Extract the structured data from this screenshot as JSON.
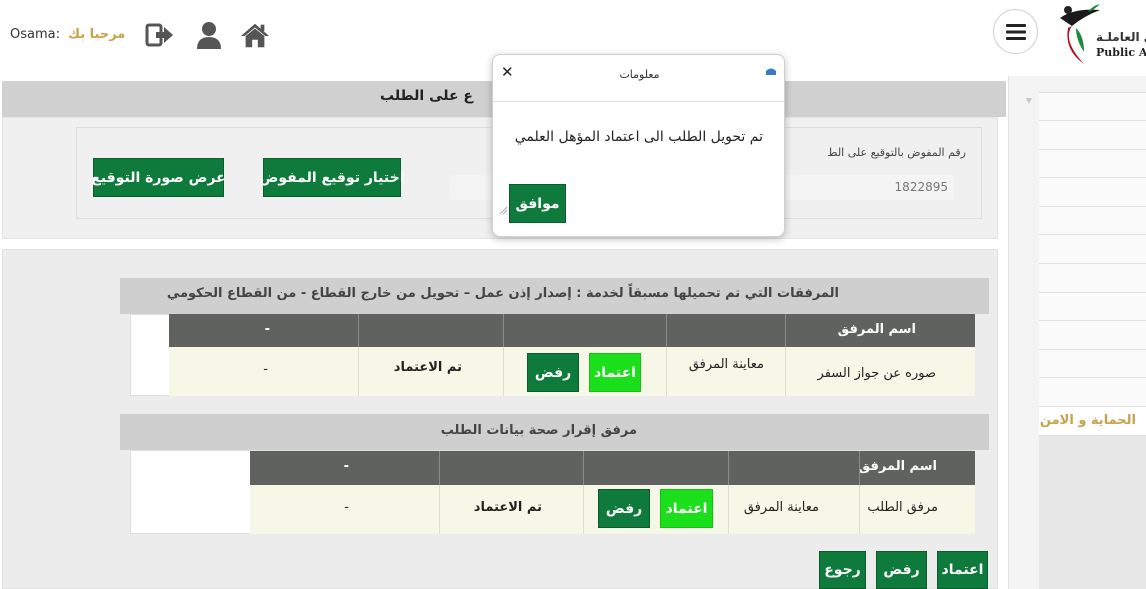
{
  "header": {
    "username": "Osama:",
    "greeting": "مرحبا بك",
    "logo_ar": "وى العاملـة",
    "logo_en": "Public Aut",
    "icons": [
      "logout-icon",
      "user-icon",
      "home-icon",
      "menu-icon"
    ]
  },
  "sidebar": {
    "selected_item": "الحماية و الامن"
  },
  "top_panel": {
    "title": "ع على الطلب",
    "field_label": "رقم المفوض بالتوقيع على الط",
    "field_value": "1822895",
    "choose_signature_btn": "اختيار توقيع المفوض",
    "view_signature_btn": "عرض صورة التوقيع"
  },
  "section1": {
    "title": "المرفقات التي تم تحميلها مسبقاً لخدمة : إصدار إذن عمل – تحويل من خارج القطاع - من القطاع الحكومي",
    "columns": [
      "اسم المرفق",
      "",
      "",
      "",
      "-"
    ],
    "row": {
      "name": "صوره عن جواز السفر",
      "view": "معاينة المرفق",
      "approve": "اعتماد",
      "reject": "رفض",
      "status": "تم الاعتماد",
      "note": "-"
    }
  },
  "section2": {
    "title": "مرفق إقرار صحة بيانات الطلب",
    "columns": [
      "اسم المرفق",
      "",
      "",
      "",
      "-"
    ],
    "row": {
      "name": "مرفق الطلب",
      "view": "معاينة المرفق",
      "approve": "اعتماد",
      "reject": "رفض",
      "status": "تم الاعتماد",
      "note": "-"
    }
  },
  "footer_buttons": {
    "approve": "اعتماد",
    "reject": "رفض",
    "back": "رجوع"
  },
  "modal": {
    "title": "معلومات",
    "message": "تم تحويل الطلب الى اعتماد المؤهل العلمي",
    "ok": "موافق",
    "close": "✕"
  },
  "colors": {
    "primary_green": "#0e7a3b",
    "bright_green": "#1adf1a",
    "table_header": "#5f625f",
    "row_bg": "#f7f7e8",
    "gold": "#c9a14a"
  }
}
